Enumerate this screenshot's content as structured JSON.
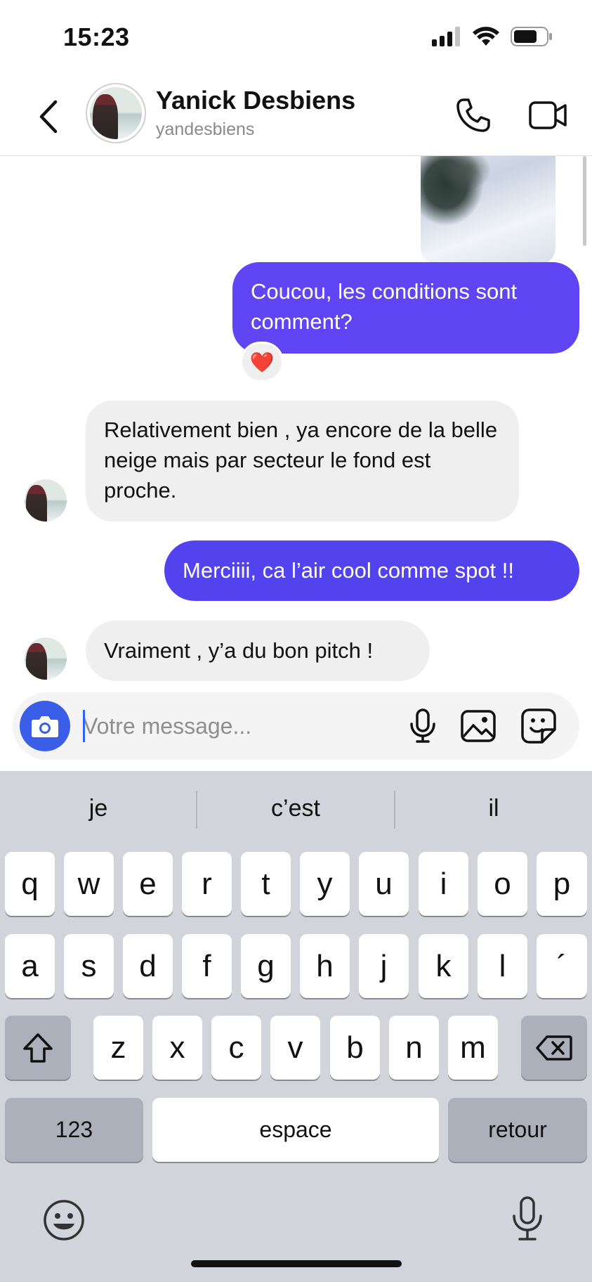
{
  "status_bar": {
    "time": "15:23"
  },
  "header": {
    "contact_name": "Yanick Desbiens",
    "contact_username": "yandesbiens"
  },
  "messages": [
    {
      "direction": "outgoing",
      "type": "photo"
    },
    {
      "direction": "outgoing",
      "type": "text",
      "text": "Coucou, les conditions sont comment?",
      "reaction": "❤️"
    },
    {
      "direction": "incoming",
      "type": "text",
      "text": "Relativement bien , ya encore de la belle neige mais par secteur le fond est proche."
    },
    {
      "direction": "outgoing",
      "type": "text",
      "text": "Merciiii, ca l’air cool comme spot !!"
    },
    {
      "direction": "incoming",
      "type": "text",
      "text": "Vraiment , y’a du bon pitch !"
    }
  ],
  "composer": {
    "placeholder": "Votre message..."
  },
  "keyboard": {
    "suggestions": [
      "je",
      "c’est",
      "il"
    ],
    "row1": [
      "q",
      "w",
      "e",
      "r",
      "t",
      "y",
      "u",
      "i",
      "o",
      "p"
    ],
    "row2": [
      "a",
      "s",
      "d",
      "f",
      "g",
      "h",
      "j",
      "k",
      "l",
      "´"
    ],
    "row3": [
      "z",
      "x",
      "c",
      "v",
      "b",
      "n",
      "m"
    ],
    "numbers_key": "123",
    "space_key": "espace",
    "return_key": "retour"
  },
  "colors": {
    "outgoing_bubble": "#6045f5",
    "incoming_bubble": "#efefef",
    "camera_button": "#3a5ee8",
    "keyboard_bg": "#d1d4da"
  },
  "icons": [
    "back-chevron-icon",
    "phone-icon",
    "video-camera-icon",
    "camera-icon",
    "microphone-icon",
    "gallery-icon",
    "sticker-icon",
    "shift-icon",
    "backspace-icon",
    "emoji-icon",
    "dictation-mic-icon",
    "signal-icon",
    "wifi-icon",
    "battery-icon"
  ]
}
